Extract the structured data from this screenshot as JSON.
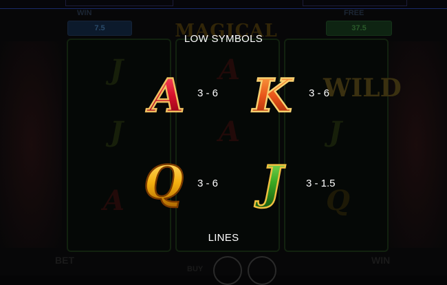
{
  "background": {
    "left_meter_label": "WIN",
    "left_meter_value": "7.5",
    "right_meter_label": "FREE",
    "right_meter_value": "37.5",
    "game_title": "MAGICAL GENIE",
    "ghost_wild": "WILD",
    "bottom_left_label": "BET",
    "bottom_right_label": "WIN",
    "buy_label": "BUY"
  },
  "paytable": {
    "title": "LOW SYMBOLS",
    "symbols": [
      {
        "letter": "A",
        "payout": "3 - 6",
        "color": "#d4102a"
      },
      {
        "letter": "K",
        "payout": "3 - 6",
        "color": "#e8561a"
      },
      {
        "letter": "Q",
        "payout": "3 - 6",
        "color": "#f4b010"
      },
      {
        "letter": "J",
        "payout": "3 - 1.5",
        "color": "#3aa822"
      }
    ],
    "next_section": "LINES"
  }
}
